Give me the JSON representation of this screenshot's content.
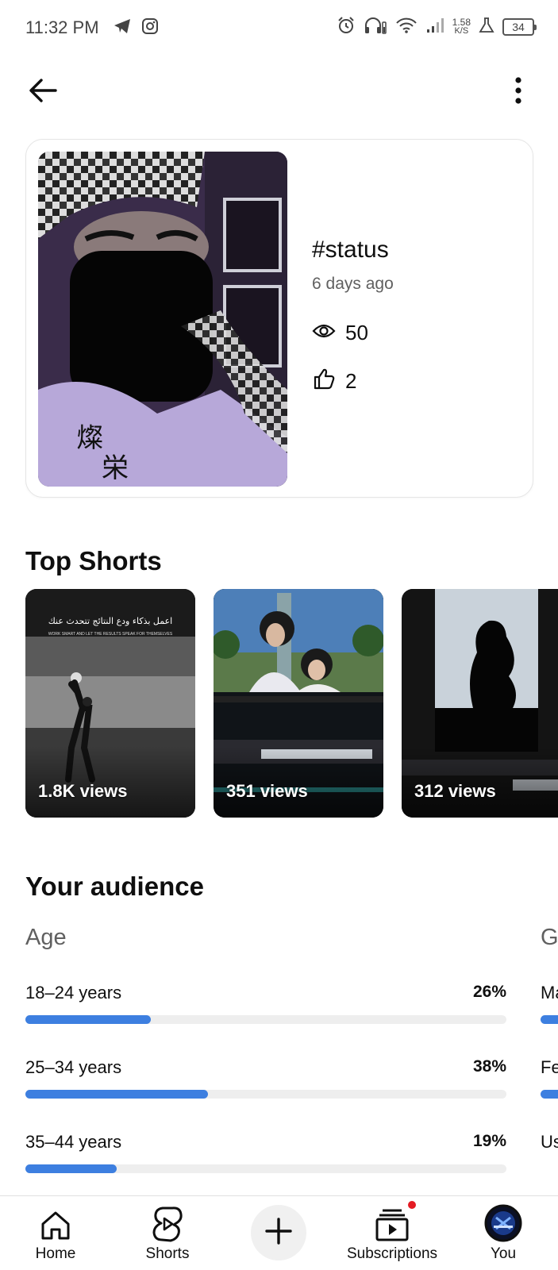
{
  "status_bar": {
    "time": "11:32 PM",
    "net_speed_value": "1.58",
    "net_speed_unit": "K/S",
    "battery": "34",
    "icons": [
      "telegram-icon",
      "instagram-icon",
      "alarm-icon",
      "headphones-icon",
      "wifi-icon",
      "signal-icon",
      "lab-flask-icon",
      "battery-icon"
    ]
  },
  "top_bar": {
    "back_icon": "arrow-left-icon",
    "menu_icon": "more-vertical-icon"
  },
  "video": {
    "title": "#status",
    "age": "6 days ago",
    "views": "50",
    "likes": "2"
  },
  "top_shorts": {
    "title": "Top Shorts",
    "items": [
      {
        "views": "1.8K views",
        "caption": "اعمل بذكاء ودع النتائج تتحدث عنك",
        "caption_en": "WORK SMART AND LET THE RESULTS SPEAK FOR THEMSELVES"
      },
      {
        "views": "351 views"
      },
      {
        "views": "312 views"
      }
    ]
  },
  "audience": {
    "title": "Your audience",
    "age": {
      "title": "Age",
      "rows": [
        {
          "label": "18–24 years",
          "percent": "26%",
          "value": 26
        },
        {
          "label": "25–34 years",
          "percent": "38%",
          "value": 38
        },
        {
          "label": "35–44 years",
          "percent": "19%",
          "value": 19
        }
      ]
    },
    "gender": {
      "title": "Gender",
      "rows": [
        {
          "label": "Male"
        },
        {
          "label": "Female"
        },
        {
          "label": "User-specified"
        }
      ]
    }
  },
  "bottom_nav": {
    "items": [
      {
        "label": "Home",
        "icon": "home-icon"
      },
      {
        "label": "Shorts",
        "icon": "shorts-icon"
      },
      {
        "label": "",
        "icon": "plus-icon"
      },
      {
        "label": "Subscriptions",
        "icon": "subscriptions-icon"
      },
      {
        "label": "You",
        "icon": "avatar"
      }
    ]
  },
  "colors": {
    "accent_bar": "#3d7fe0",
    "bar_track": "#eeeeee",
    "notification_dot": "#e41b23"
  }
}
